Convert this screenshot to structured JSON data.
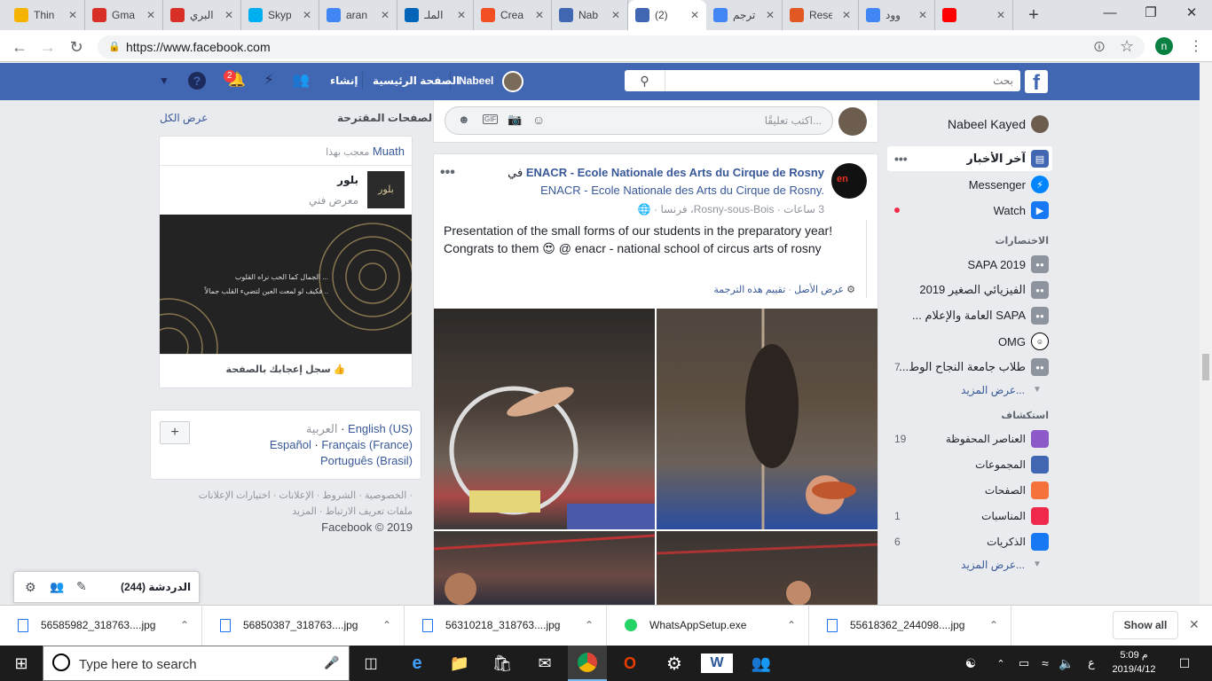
{
  "browser": {
    "tabs": [
      {
        "title": "Thin",
        "icon": "location-pin-icon",
        "color": "#f4b400"
      },
      {
        "title": "Gma",
        "icon": "gmail-icon",
        "color": "#d93025"
      },
      {
        "title": "البري",
        "icon": "gmail-icon",
        "color": "#d93025"
      },
      {
        "title": "Skyp",
        "icon": "skype-icon",
        "color": "#00aff0"
      },
      {
        "title": "aran",
        "icon": "google-icon",
        "color": "#4285f4"
      },
      {
        "title": "الملـ",
        "icon": "onedrive-icon",
        "color": "#0364b8"
      },
      {
        "title": "Crea",
        "icon": "microsoft-icon",
        "color": "#f25022"
      },
      {
        "title": "Nab",
        "icon": "facebook-icon",
        "color": "#4267b2"
      },
      {
        "title": "(2) ‏",
        "icon": "facebook-icon",
        "color": "#4267b2"
      },
      {
        "title": "ترجم",
        "icon": "google-translate-icon",
        "color": "#4285f4"
      },
      {
        "title": "Rese",
        "icon": "sd-icon",
        "color": "#e25822"
      },
      {
        "title": "وود",
        "icon": "google-icon",
        "color": "#4285f4"
      },
      {
        "title": "",
        "icon": "youtube-icon",
        "color": "#ff0000"
      }
    ],
    "url": "https://www.facebook.com",
    "profile_initial": "n"
  },
  "fb_header": {
    "search_placeholder": "بحث",
    "user_name": "Nabeel",
    "home": "الصفحة الرئيسية",
    "create": "إنشاء",
    "notif_count": "2"
  },
  "left": {
    "suggested_title": "الصفحات المقترحة",
    "see_all": "عرض الكل",
    "liked_by": "Muath",
    "liked_by_suffix": "معجب بهذا",
    "page_name": "بلور",
    "page_category": "معرض فني",
    "banner_line1": "الجمال كما الحب نراه القلوب ...",
    "banner_line2": "فكيف لو لمعت العين لتضيء القلب جمالاً ..",
    "banner_logo": "بلور",
    "like_page": "سجل إعجابك بالصفحة",
    "lang_current": "العربية",
    "langs": [
      "English (US)",
      "Español",
      "Français (France)",
      "Português (Brasil)"
    ],
    "footer_line1": "الخصوصية · الشروط · الإعلانات · اختيارات الإعلانات ·",
    "footer_line2": "ملفات تعريف الارتباط · المزيد",
    "copyright": "Facebook © 2019"
  },
  "chat": {
    "label": "الدردشة",
    "count": "(244)"
  },
  "composer": {
    "placeholder": "اكتب تعليقًا..."
  },
  "post": {
    "page_name": "ENACR - Ecole Nationale des Arts du Cirque de Rosny",
    "in_word": "في",
    "subline": "ENACR - Ecole Nationale des Arts du Cirque de Rosny.",
    "time": "3 ساعات",
    "location": "Rosny-sous-Bois، فرنسا",
    "text": "Presentation of the small forms of our students in the preparatory year! Congrats to them 😍 @ enacr - national school of circus arts of rosny",
    "see_original": "عرض الأصل",
    "rate_translation": "تقييم هذه الترجمة"
  },
  "right_nav": {
    "user": "Nabeel Kayed",
    "items": [
      {
        "label": "آخر الأخبار",
        "icon": "news-feed-icon"
      },
      {
        "label": "Messenger",
        "icon": "messenger-icon"
      },
      {
        "label": "Watch",
        "icon": "watch-icon"
      }
    ],
    "shortcuts_title": "الاختصارات",
    "shortcuts": [
      {
        "label": "SAPA 2019",
        "count": ""
      },
      {
        "label": "الفيزيائي الصغير 2019",
        "count": ""
      },
      {
        "label": "SAPA العامة والإعلام ...",
        "count": ""
      },
      {
        "label": "OMG",
        "count": ""
      },
      {
        "label": "طلاب جامعة النجاح الوط...",
        "count": "7"
      }
    ],
    "see_more_1": "عرض المزيد...",
    "explore_title": "استكشاف",
    "explore": [
      {
        "label": "العناصر المحفوظة",
        "count": "19",
        "icon": "saved-icon",
        "color": "#8c59c9"
      },
      {
        "label": "المجموعات",
        "count": "",
        "icon": "groups-icon",
        "color": "#4267b2"
      },
      {
        "label": "الصفحات",
        "count": "",
        "icon": "pages-flag-icon",
        "color": "#f5733b"
      },
      {
        "label": "المناسبات",
        "count": "1",
        "icon": "events-icon",
        "color": "#f02849"
      },
      {
        "label": "الذكريات",
        "count": "6",
        "icon": "memories-icon",
        "color": "#1877f2"
      }
    ],
    "see_more_2": "عرض المزيد..."
  },
  "downloads": {
    "files": [
      "56585982_318763....jpg",
      "56850387_318763....jpg",
      "56310218_318763....jpg",
      "WhatsAppSetup.exe",
      "55618362_244098....jpg"
    ],
    "show_all": "Show all"
  },
  "taskbar": {
    "search_placeholder": "Type here to search",
    "time": "5:09 م",
    "date": "2019/4/12",
    "lang": "ع"
  }
}
